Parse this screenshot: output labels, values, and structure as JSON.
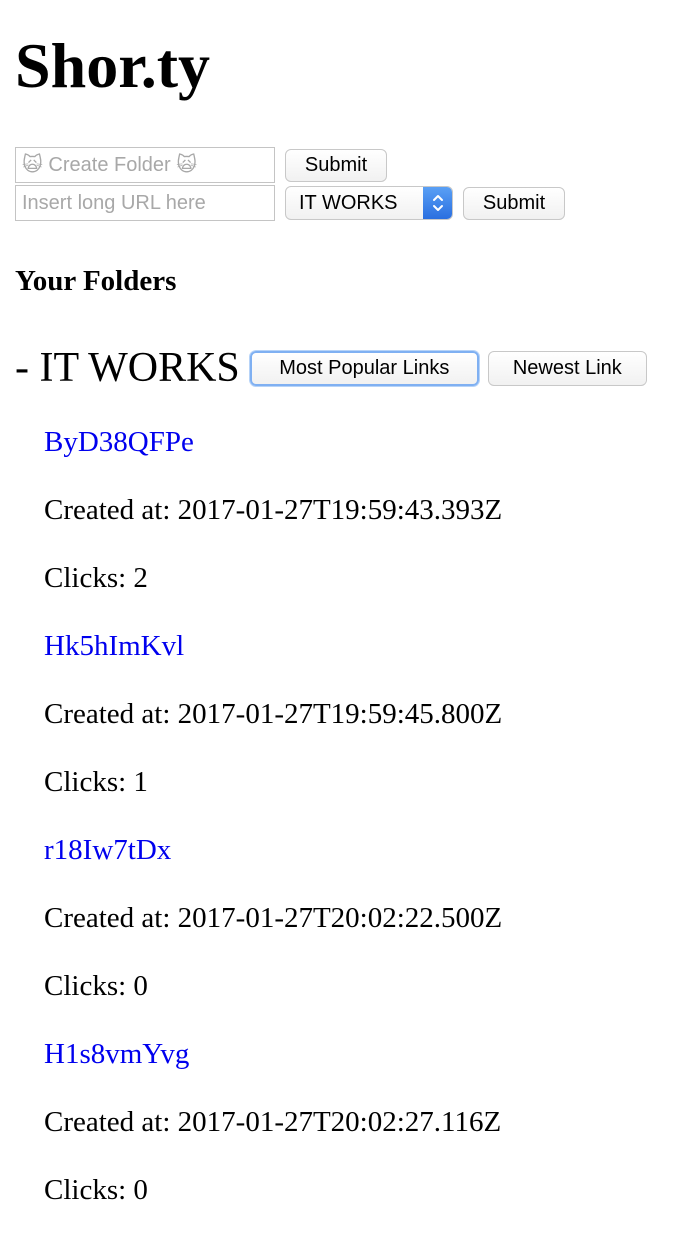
{
  "app": {
    "title": "Shor.ty"
  },
  "folder_form": {
    "placeholder": "🙀 Create Folder 🙀",
    "submit_label": "Submit"
  },
  "url_form": {
    "placeholder": "Insert long URL here",
    "selected_folder": "IT WORKS",
    "submit_label": "Submit"
  },
  "folders_section": {
    "title": "Your Folders"
  },
  "folder": {
    "name": "- IT WORKS",
    "popular_label": "Most Popular Links",
    "newest_label": "Newest Link",
    "links": [
      {
        "short_code": "ByD38QFPe",
        "created": "Created at: 2017-01-27T19:59:43.393Z",
        "clicks": "Clicks: 2"
      },
      {
        "short_code": "Hk5hImKvl",
        "created": "Created at: 2017-01-27T19:59:45.800Z",
        "clicks": "Clicks: 1"
      },
      {
        "short_code": "r18Iw7tDx",
        "created": "Created at: 2017-01-27T20:02:22.500Z",
        "clicks": "Clicks: 0"
      },
      {
        "short_code": "H1s8vmYvg",
        "created": "Created at: 2017-01-27T20:02:27.116Z",
        "clicks": "Clicks: 0"
      }
    ]
  },
  "colors": {
    "link": "#0000ee",
    "select_accent": "#2a6fe0",
    "focus_ring": "#7fb0f2"
  },
  "icons": {
    "select_arrows": "chevron-up-down-icon"
  }
}
